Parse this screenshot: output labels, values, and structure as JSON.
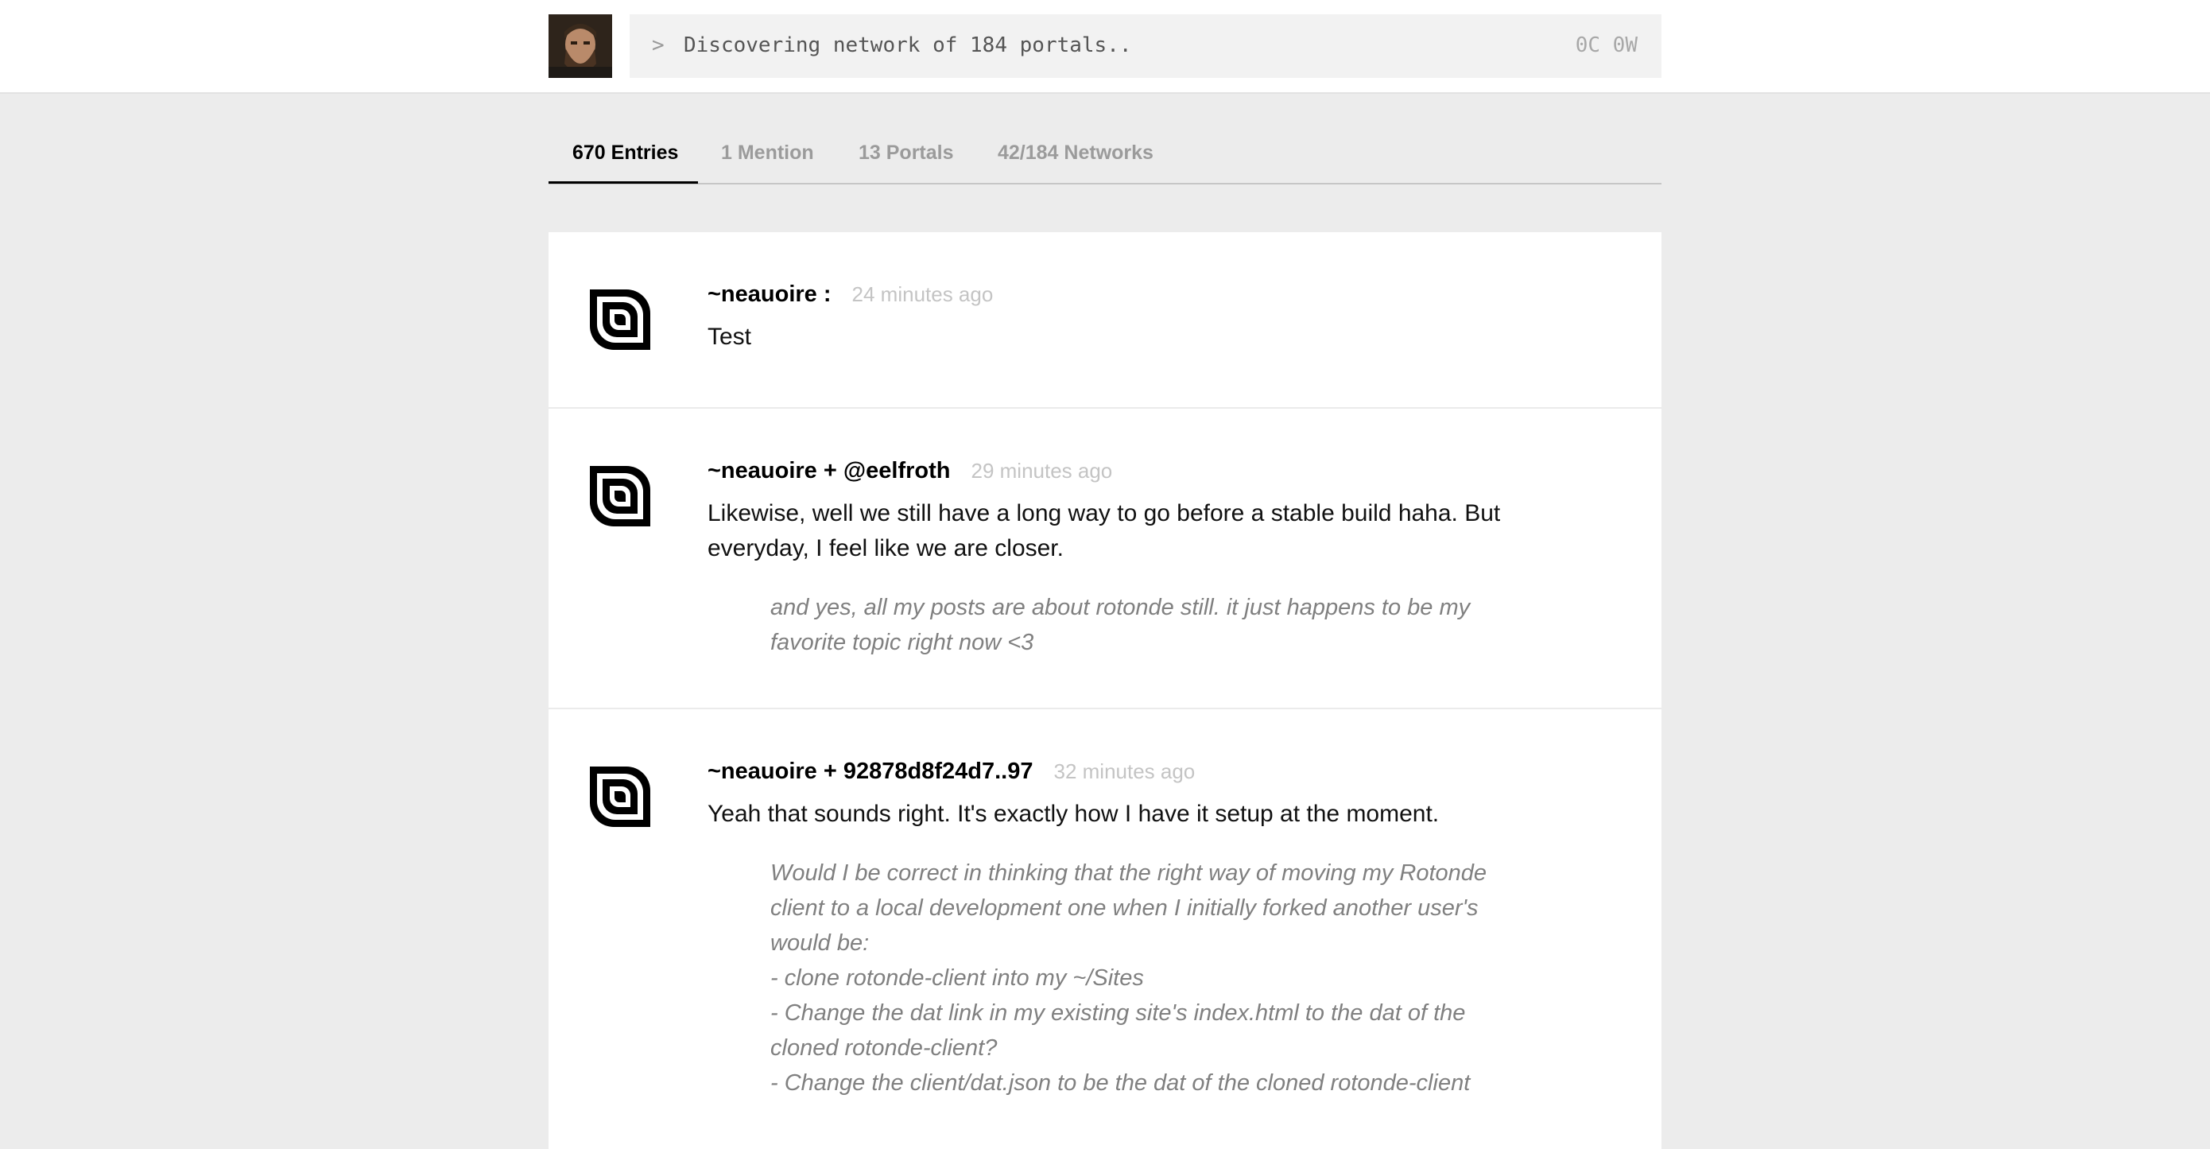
{
  "header": {
    "avatar_label": "profile-photo",
    "prompt": ">",
    "command_text": "Discovering network of 184 portals..",
    "counters": "0C 0W"
  },
  "tabs": [
    {
      "label": "670 Entries",
      "active": true
    },
    {
      "label": "1 Mention",
      "active": false
    },
    {
      "label": "13 Portals",
      "active": false
    },
    {
      "label": "42/184 Networks",
      "active": false
    }
  ],
  "entries": [
    {
      "author": "~neauoire :",
      "time": "24 minutes ago",
      "message": "Test",
      "quote": []
    },
    {
      "author": "~neauoire + @eelfroth",
      "time": "29 minutes ago",
      "message": "Likewise, well we still have a long way to go before a stable build haha. But everyday, I feel like we are closer.",
      "quote": [
        "and yes, all my posts are about rotonde still. it just happens to be my favorite topic right now <3"
      ]
    },
    {
      "author": "~neauoire + 92878d8f24d7..97",
      "time": "32 minutes ago",
      "message": "Yeah that sounds right. It's exactly how I have it setup at the moment.",
      "quote": [
        "Would I be correct in thinking that the right way of moving my Rotonde client to a local development one when I initially forked another user's would be:",
        "- clone rotonde-client into my ~/Sites",
        "- Change the dat link in my existing site's index.html to the dat of the cloned rotonde-client?",
        "- Change the client/dat.json to be the dat of the cloned rotonde-client"
      ]
    }
  ],
  "colors": {
    "page_bg": "#ececec",
    "panel_bg": "#ffffff",
    "muted_text": "#9b9b9b",
    "timestamp": "#c4c4c4",
    "quote_text": "#808080"
  },
  "icons": {
    "entry_icon": "rotonde-logo-icon"
  }
}
